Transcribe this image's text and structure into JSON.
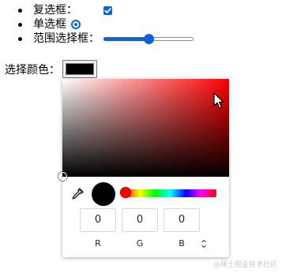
{
  "list": {
    "items": [
      {
        "label": "复选框：",
        "control": "checkbox",
        "checked": true
      },
      {
        "label": "单选框",
        "control": "radio",
        "checked": true
      },
      {
        "label": "范围选择框：",
        "control": "range",
        "value_fraction": 0.5
      }
    ]
  },
  "color_input": {
    "label": "选择颜色：",
    "value": "#000000"
  },
  "color_picker": {
    "hue_color": "#ff0000",
    "current_color": "#000000",
    "rgb": {
      "r": "0",
      "g": "0",
      "b": "0"
    },
    "labels": {
      "r": "R",
      "g": "G",
      "b": "B"
    }
  },
  "icons": {
    "eyedropper": "eyedropper-icon",
    "format_toggle": "up-down-chevron-icon",
    "cursor": "mouse-pointer-icon"
  },
  "watermark": "@稀土掘金技术社区"
}
